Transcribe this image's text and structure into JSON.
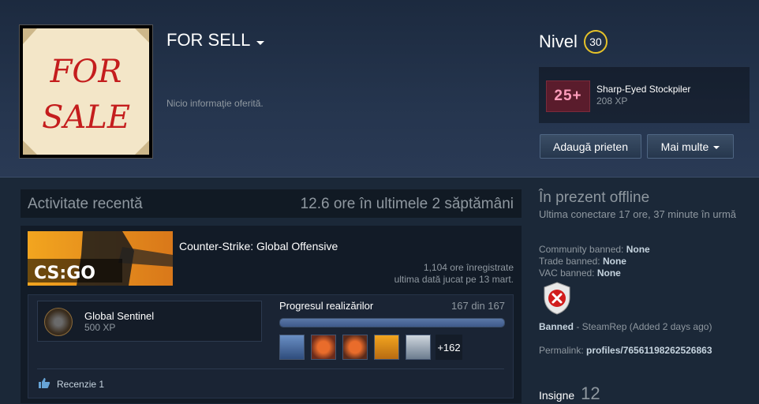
{
  "profile": {
    "name": "FOR SELL",
    "summary": "Nicio informaţie oferită.",
    "avatar_text": [
      "FOR",
      "SALE"
    ]
  },
  "level": {
    "label": "Nivel",
    "value": "30"
  },
  "featured_badge": {
    "icon_text": "25+",
    "name": "Sharp-Eyed Stockpiler",
    "xp": "208 XP"
  },
  "buttons": {
    "add_friend": "Adaugă prieten",
    "more": "Mai multe"
  },
  "activity": {
    "title": "Activitate recentă",
    "hours": "12.6 ore în ultimele 2 săptămâni",
    "game": {
      "logo_text": "CS:GO",
      "name": "Counter-Strike: Global Offensive",
      "hours_on_record": "1,104 ore înregistrate",
      "last_played": "ultima dată jucat pe 13 mart."
    },
    "achievement": {
      "name": "Global Sentinel",
      "xp": "500 XP"
    },
    "progress": {
      "label": "Progresul realizărilor",
      "count": "167 din 167",
      "fraction": 1.0
    },
    "achievement_thumbs": [
      "achievement-100-icon",
      "achievement-5-icon",
      "achievement-5-icon",
      "achievement-defuse-icon",
      "achievement-soldier-icon"
    ],
    "more_achievements": "+162",
    "review": "Recenzie 1"
  },
  "status": {
    "state": "În prezent offline",
    "last_online": "Ultima conectare 17 ore, 37 minute în urmă"
  },
  "bans": {
    "community_label": "Community banned:",
    "community_value": "None",
    "trade_label": "Trade banned:",
    "trade_value": "None",
    "vac_label": "VAC banned:",
    "vac_value": "None"
  },
  "steamrep": {
    "status": "Banned",
    "detail": " - SteamRep (Added 2 days ago)"
  },
  "permalink": {
    "label": "Permalink: ",
    "value": "profiles/76561198262526863"
  },
  "badges": {
    "label": "Insigne",
    "count": "12"
  },
  "colors": {
    "background": "#1b2838",
    "level_ring": "#e6c229",
    "text_muted": "#8f98a0",
    "text_light": "#c6d4df"
  }
}
